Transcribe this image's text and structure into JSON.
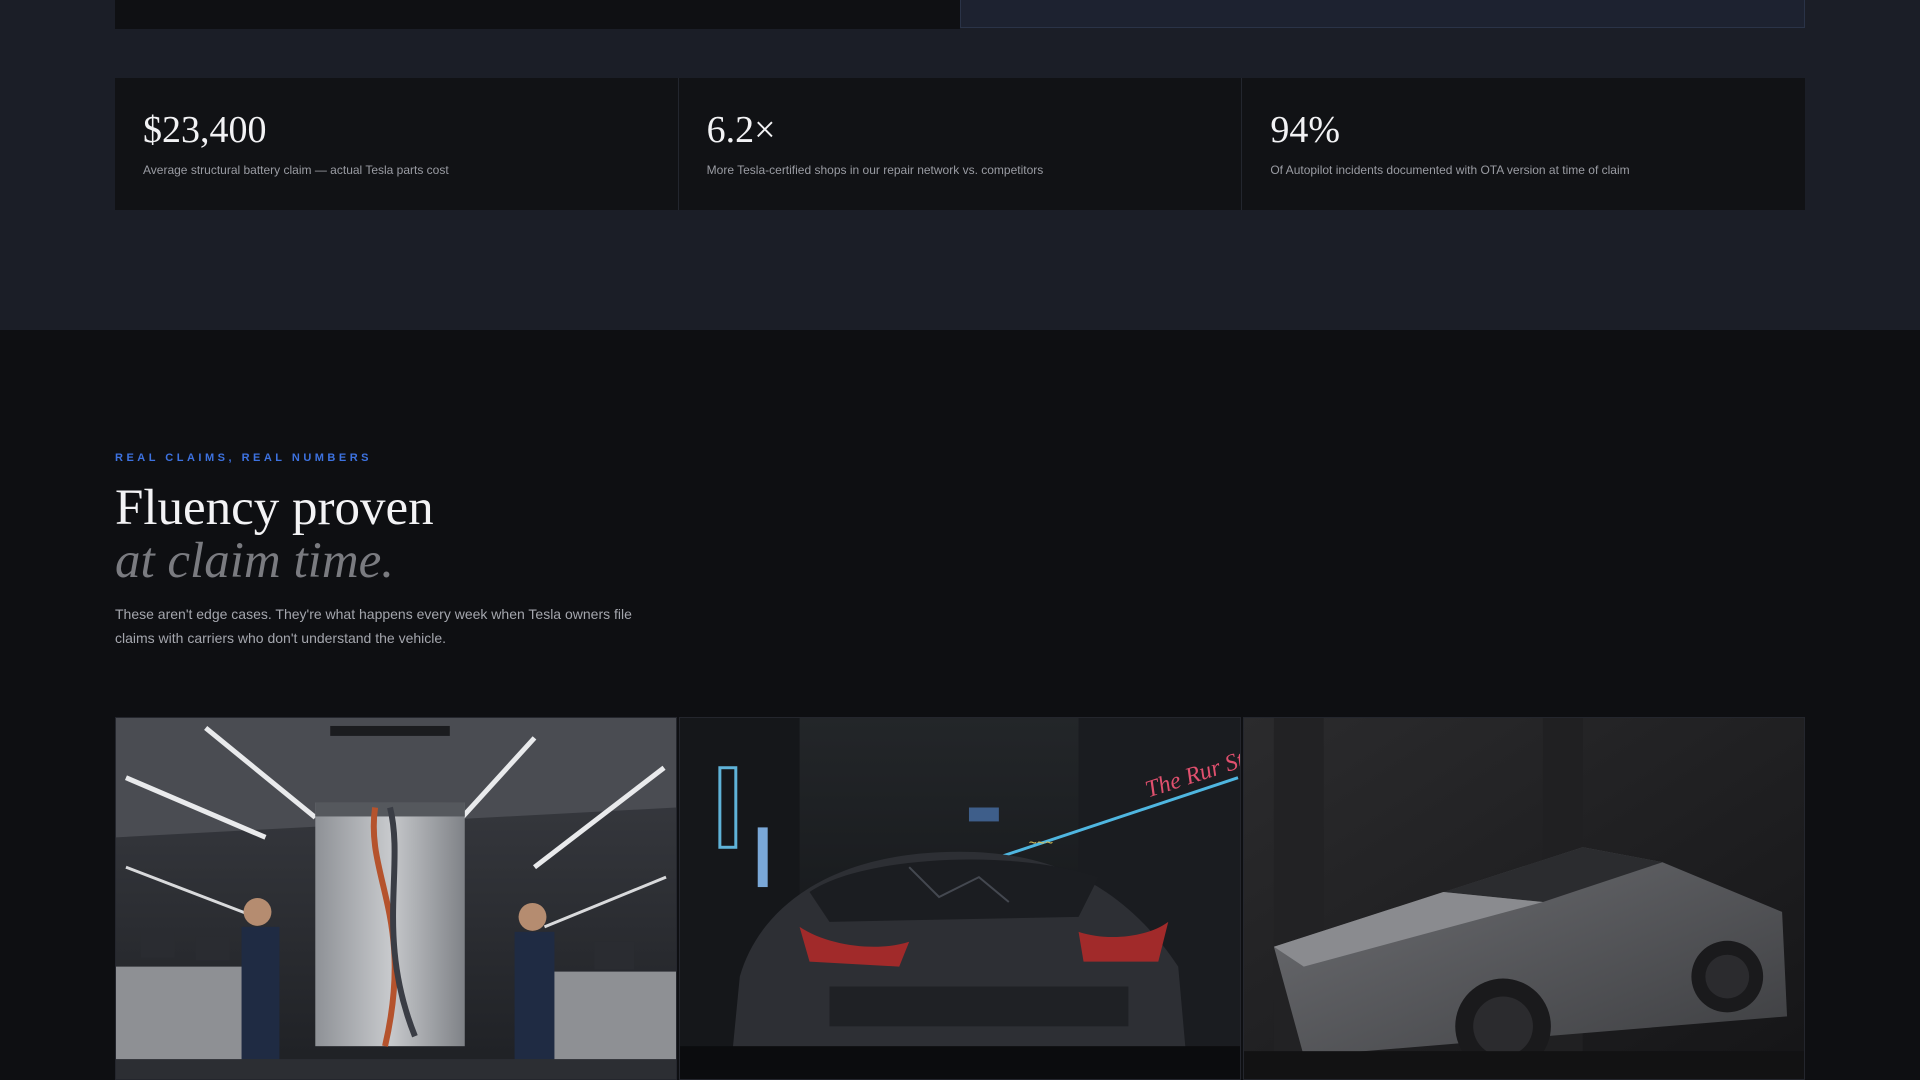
{
  "stats": [
    {
      "value": "$23,400",
      "desc": "Average structural battery claim — actual Tesla parts cost"
    },
    {
      "value": "6.2×",
      "desc": "More Tesla-certified shops in our repair network vs. competitors"
    },
    {
      "value": "94%",
      "desc": "Of Autopilot incidents documented with OTA version at time of claim"
    }
  ],
  "section": {
    "eyebrow": "REAL CLAIMS, REAL NUMBERS",
    "heading_line1": "Fluency proven",
    "heading_line2": "at claim time.",
    "lede": "These aren't edge cases. They're what happens every week when Tesla owners file claims with carriers who don't understand the vehicle."
  },
  "gallery": [
    {
      "icon": "battery-workshop-image"
    },
    {
      "icon": "damaged-car-night-image"
    },
    {
      "icon": "cybertruck-studio-image"
    }
  ],
  "colors": {
    "accent": "#3d72e0",
    "top_bg": "#1b1e27",
    "page_bg": "#0e0f12"
  }
}
